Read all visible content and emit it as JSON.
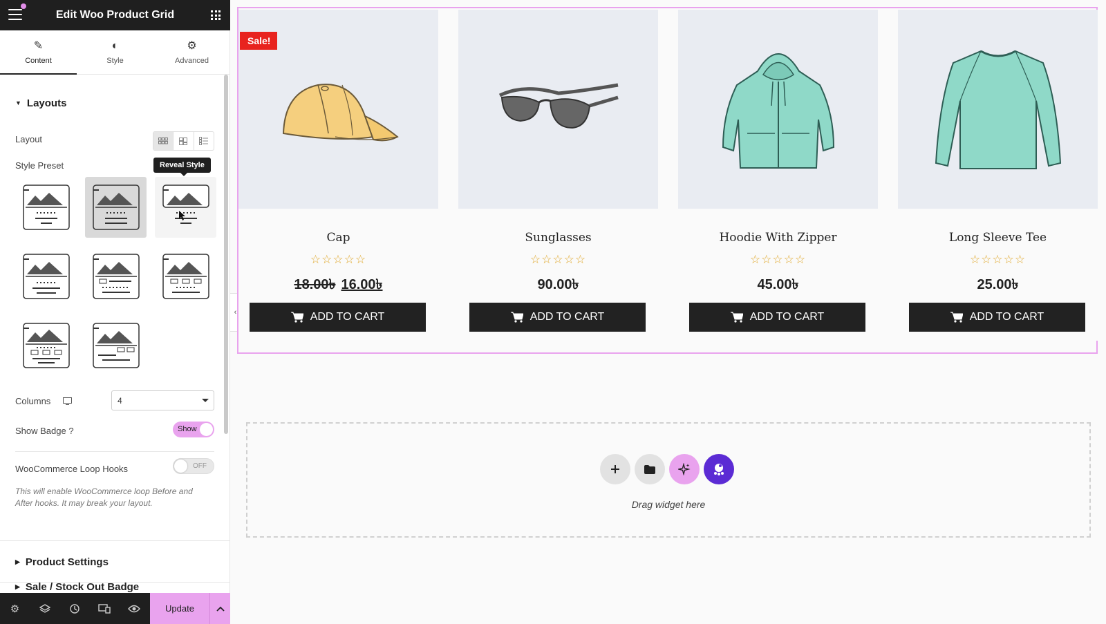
{
  "topbar": {
    "title": "Edit Woo Product Grid"
  },
  "tabs": [
    {
      "label": "Content",
      "icon": "pencil-icon",
      "active": true
    },
    {
      "label": "Style",
      "icon": "half-circle-icon",
      "active": false
    },
    {
      "label": "Advanced",
      "icon": "gear-icon",
      "active": false
    }
  ],
  "panel": {
    "layouts_heading": "Layouts",
    "layout_label": "Layout",
    "style_preset_label": "Style Preset",
    "tooltip": "Reveal Style",
    "columns_label": "Columns",
    "columns_value": "4",
    "show_badge_label": "Show Badge ?",
    "show_badge_state": "Show",
    "loop_hooks_label": "WooCommerce Loop Hooks",
    "loop_hooks_state": "OFF",
    "loop_hooks_note": "This will enable WooCommerce loop Before and After hooks. It may break your layout.",
    "product_settings_heading": "Product Settings",
    "sale_stock_heading": "Sale / Stock Out Badge"
  },
  "bottombar": {
    "update_label": "Update"
  },
  "badge": {
    "label": "Sale!"
  },
  "products": [
    {
      "name": "Cap",
      "stars": "☆☆☆☆☆",
      "old_price": "18.00৳",
      "price": "16.00৳",
      "button": "ADD TO CART"
    },
    {
      "name": "Sunglasses",
      "stars": "☆☆☆☆☆",
      "price": "90.00৳",
      "button": "ADD TO CART"
    },
    {
      "name": "Hoodie With Zipper",
      "stars": "☆☆☆☆☆",
      "price": "45.00৳",
      "button": "ADD TO CART"
    },
    {
      "name": "Long Sleeve Tee",
      "stars": "☆☆☆☆☆",
      "price": "25.00৳",
      "button": "ADD TO CART"
    }
  ],
  "dropzone": {
    "hint": "Drag widget here"
  },
  "colors": {
    "accent": "#e9a3ee",
    "dark": "#1f1f1f",
    "sale": "#e8231f",
    "stars": "#e0a92e",
    "mint": "#8fd9c8"
  }
}
